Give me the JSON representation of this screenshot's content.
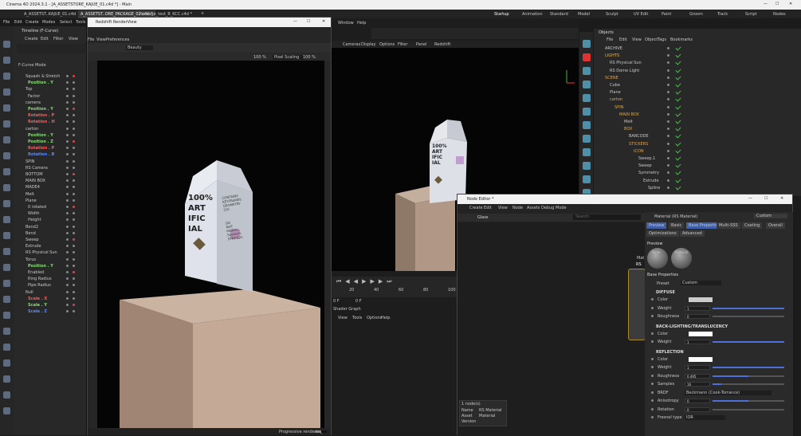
{
  "app_title": "Cinema 4D 2024.3.1 - [A_ASSETSTORE_KAJUE_01.c4d *] - Main",
  "tabs": [
    "A_ASSETST..KAJUE_01.c4d",
    "A_ASSETST..ORE_PACKAGE_02.c4d *",
    "Package_test_R_KCC.c4d *"
  ],
  "workspace_tabs": [
    "Startup",
    "Animation",
    "Standard",
    "Model",
    "Sculpt",
    "UV Edit",
    "Paint",
    "Groom",
    "Track",
    "Script",
    "Nodes"
  ],
  "main_menu": [
    "File",
    "Edit",
    "Create",
    "Modes",
    "Select",
    "Tools"
  ],
  "timeline": {
    "title": "Timeline (F-Curve)",
    "menu": [
      "Create",
      "Edit",
      "Filter",
      "View"
    ],
    "mode": "F-Curve Mode",
    "tracks": [
      "Squash & Stretch",
      "Position . Y",
      "Top",
      "Factor",
      "camera",
      "Position . Y",
      "Rotation . P",
      "Rotation . H",
      "carton",
      "Position . Y",
      "Position . Z",
      "Rotation . P",
      "Rotation . B",
      "SPIN",
      "RS Camera",
      "BOTTOM",
      "MAIN BOX",
      "MADE4",
      "Melt",
      "Plane",
      "0 rotated",
      "Width",
      "Height",
      "Bend2",
      "Bend",
      "Sweep",
      "Extrude",
      "RS Physical Sun",
      "Torus",
      "Position . Y",
      "Enabled",
      "Ring Radius",
      "Pipe Radius",
      "Null",
      "Scale . X",
      "Scale . Y",
      "Scale . Z"
    ]
  },
  "rs_view": {
    "title": "Redshift RenderView",
    "menu": [
      "File",
      "View",
      "Preferences"
    ],
    "beauty": "Beauty",
    "zoom1": "100 %",
    "zoom2": "100 %",
    "scaling": "Pixel Scaling",
    "status": "Progressive rendering",
    "progress": "50",
    "carton_front": [
      "100%",
      "ART",
      "IFIC",
      "IAL"
    ],
    "carton_side": [
      "CONTAINS",
      "KEYFRAMES",
      "GEOMETRY",
      "CGI",
      "DO",
      "NOT",
      "MORPH,",
      "SQUASH,",
      "STRETCH."
    ]
  },
  "viewport": {
    "menu_top": [
      "Window",
      "Help"
    ],
    "menu": [
      "Cameras",
      "Display",
      "Options",
      "Filter",
      "Panel",
      "Redshift"
    ],
    "carton": [
      "100%",
      "ART",
      "IFIC",
      "IAL"
    ],
    "frames": [
      "20",
      "40",
      "60",
      "80",
      "100"
    ],
    "frame_start": "0 F",
    "frame_end": "0 F",
    "shader_graph": "Shader Graph",
    "shader_menu": [
      "View",
      "Tools",
      "Options",
      "Help"
    ]
  },
  "objects": {
    "title": "Objects",
    "menu": [
      "File",
      "Edit",
      "View",
      "Object",
      "Tags",
      "Bookmarks"
    ],
    "items": [
      "ARCHIVE",
      "LIGHTS",
      "RS Physical Sun",
      "RS Dome Light",
      "SCENE",
      "Cube",
      "Plane",
      "carton",
      "SPIN",
      "MAIN BOX",
      "Melt",
      "BOX",
      "BARCODE",
      "STICKERS",
      "ICON",
      "Sweep.1",
      "Sweep",
      "Symmetry",
      "Extrude",
      "Spline"
    ]
  },
  "node_editor": {
    "title": "Node Editor *",
    "menu": [
      "Create",
      "Edit",
      "View",
      "Node",
      "Assets",
      "Debug",
      "Mode"
    ],
    "tab": "Glass",
    "search_placeholder": "Search",
    "material_name": "Material (RS Material)",
    "layout": "Custom",
    "prop_tabs": [
      "Preview",
      "Basic",
      "Base Properties",
      "Multi-SSS",
      "Coating",
      "Overall"
    ],
    "prop_tabs2": [
      "Optimizations",
      "Advanced"
    ],
    "preview_label": "Preview",
    "preview_btns": [
      "Node",
      "Material"
    ],
    "base_props": "Base Properties",
    "preset_label": "Preset",
    "preset_value": "Custom",
    "diffuse": "DIFFUSE",
    "color": "Color",
    "weight": "Weight",
    "roughness": "Roughness",
    "diffuse_weight": "1",
    "diffuse_rough": "0",
    "backlight": "BACK-LIGHTING/TRANSLUCENCY",
    "bl_weight": "1",
    "reflection": "REFLECTION",
    "refl_weight": "1",
    "refl_rough": "0.495",
    "samples_label": "Samples",
    "samples": "16",
    "brdf_label": "BRDF",
    "brdf": "Beckmann (Cook-Torrance)",
    "aniso_label": "Anisotropy",
    "aniso": "0",
    "rotation_label": "Rotation",
    "rotation": "0",
    "fresnel_label": "Fresnel type",
    "fresnel": "IOR",
    "node_label": "RS",
    "node_mat": "Mat",
    "info_header": "1 node(s)",
    "info_name_label": "Name",
    "info_name": "RS Material",
    "info_asset_label": "Asset",
    "info_asset": "Material",
    "info_version_label": "Version"
  }
}
